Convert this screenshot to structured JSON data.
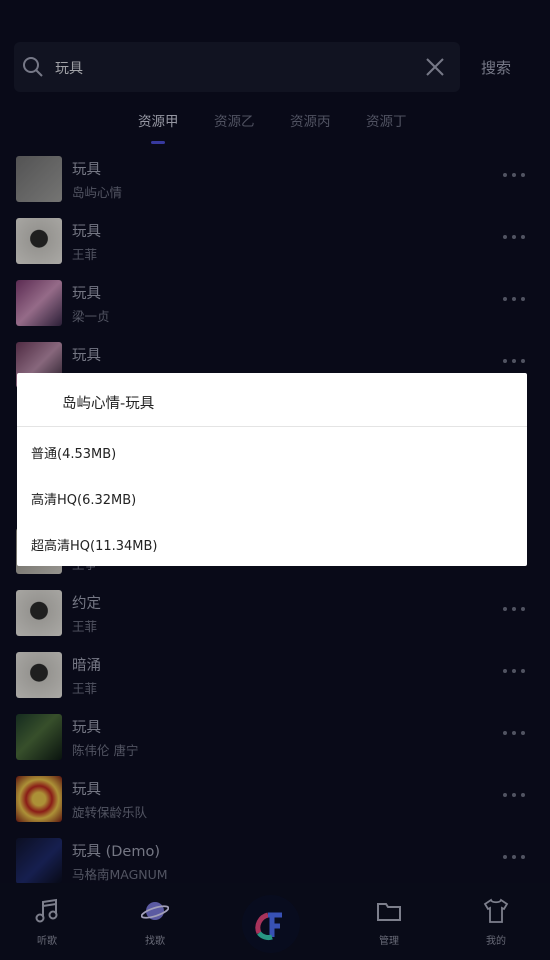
{
  "search": {
    "query": "玩具",
    "button_label": "搜索"
  },
  "tabs": [
    {
      "label": "资源甲",
      "active": true
    },
    {
      "label": "资源乙",
      "active": false
    },
    {
      "label": "资源丙",
      "active": false
    },
    {
      "label": "资源丁",
      "active": false
    }
  ],
  "results": [
    {
      "title": "玩具",
      "artist": "岛屿心情"
    },
    {
      "title": "玩具",
      "artist": "王菲"
    },
    {
      "title": "玩具",
      "artist": "梁一贞"
    },
    {
      "title": "玩具",
      "artist": ""
    },
    {
      "title": "",
      "artist": "王争"
    },
    {
      "title": "约定",
      "artist": "王菲"
    },
    {
      "title": "暗涌",
      "artist": "王菲"
    },
    {
      "title": "玩具",
      "artist": "陈伟伦  唐宁"
    },
    {
      "title": "玩具",
      "artist": "旋转保龄乐队"
    },
    {
      "title": "玩具 (Demo)",
      "artist": "马格南MAGNUM"
    }
  ],
  "dialog": {
    "title": "岛屿心情-玩具",
    "options": [
      "普通(4.53MB)",
      "高清HQ(6.32MB)",
      "超高清HQ(11.34MB)"
    ]
  },
  "bottom_nav": [
    {
      "label": "听歌",
      "icon": "music-note-icon"
    },
    {
      "label": "找歌",
      "icon": "planet-icon"
    },
    {
      "label": "管理",
      "icon": "folder-icon"
    },
    {
      "label": "我的",
      "icon": "tshirt-icon"
    }
  ],
  "colors": {
    "background": "#0c0e20",
    "accent": "#4a4cd3",
    "dialog": "#ffffff"
  }
}
